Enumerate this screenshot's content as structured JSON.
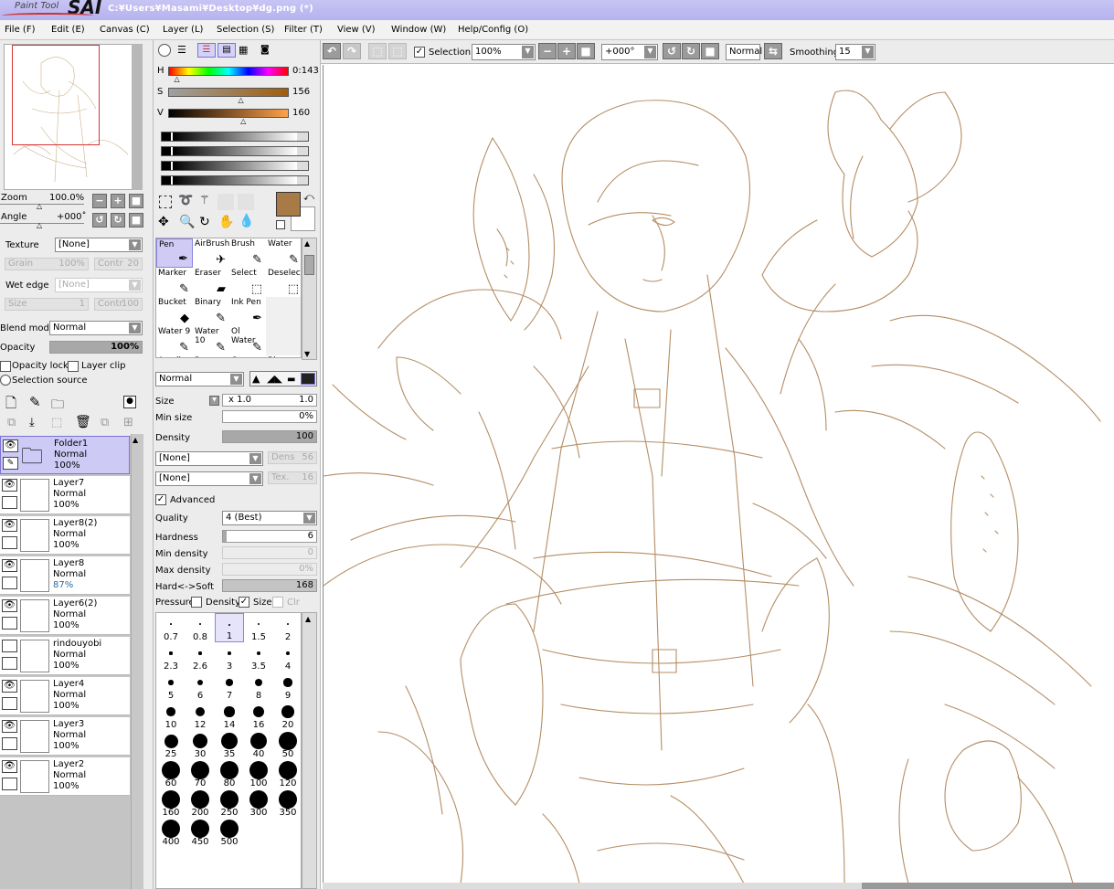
{
  "window": {
    "title": "C:¥Users¥Masami¥Desktop¥dg.png (*)",
    "app_logo_small": "Paint Tool",
    "app_logo_big": "SAI"
  },
  "menu": [
    "File (F)",
    "Edit (E)",
    "Canvas (C)",
    "Layer (L)",
    "Selection (S)",
    "Filter (T)",
    "View (V)",
    "Window (W)",
    "Help/Config (O)"
  ],
  "navigator": {
    "zoom_label": "Zoom",
    "zoom_value": "100.0%",
    "angle_label": "Angle",
    "angle_value": "+000˚"
  },
  "texture": {
    "label": "Texture",
    "value": "[None]",
    "grain_label": "Grain",
    "grain_value": "100%",
    "contr_label": "Contr",
    "contr_value": "20"
  },
  "wetedge": {
    "label": "Wet edge",
    "value": "[None]",
    "size_label": "Size",
    "size_value": "1",
    "contr_label": "Contr",
    "contr_value": "100"
  },
  "blend": {
    "label": "Blend mode",
    "value": "Normal",
    "opacity_label": "Opacity",
    "opacity_value": "100%",
    "opacity_level": 1.0,
    "opacity_lock": "Opacity lock",
    "layer_clip": "Layer clip",
    "selection_source": "Selection source"
  },
  "layers": [
    {
      "name": "Folder1",
      "mode": "Normal",
      "opacity": "100%",
      "visible": true,
      "folder": true,
      "active": true
    },
    {
      "name": "Layer7",
      "mode": "Normal",
      "opacity": "100%",
      "visible": true
    },
    {
      "name": "Layer8(2)",
      "mode": "Normal",
      "opacity": "100%",
      "visible": true
    },
    {
      "name": "Layer8",
      "mode": "Normal",
      "opacity": "87%",
      "visible": true
    },
    {
      "name": "Layer6(2)",
      "mode": "Normal",
      "opacity": "100%",
      "visible": true
    },
    {
      "name": "rindouyobi",
      "mode": "Normal",
      "opacity": "100%",
      "visible": false
    },
    {
      "name": "Layer4",
      "mode": "Normal",
      "opacity": "100%",
      "visible": true
    },
    {
      "name": "Layer3",
      "mode": "Normal",
      "opacity": "100%",
      "visible": true
    },
    {
      "name": "Layer2",
      "mode": "Normal",
      "opacity": "100%",
      "visible": true
    }
  ],
  "color": {
    "h_label": "H",
    "h_value": "0:143",
    "s_label": "S",
    "s_value": "156",
    "v_label": "V",
    "v_value": "160",
    "h_level": 0.08,
    "s_level": 0.61,
    "v_level": 0.63,
    "primary": "#a87a45",
    "secondary": "#ffffff"
  },
  "tools": [
    {
      "name": "Pen",
      "icon": "✒",
      "active": true
    },
    {
      "name": "AirBrush",
      "icon": "✈"
    },
    {
      "name": "Brush",
      "icon": "✎"
    },
    {
      "name": "Water",
      "icon": "✎"
    },
    {
      "name": "Marker",
      "icon": "✎"
    },
    {
      "name": "Eraser",
      "icon": "▰"
    },
    {
      "name": "Select",
      "icon": "⬚"
    },
    {
      "name": "Deselect",
      "icon": "⬚"
    },
    {
      "name": "Bucket",
      "icon": "◆"
    },
    {
      "name": "Binary",
      "icon": "✎"
    },
    {
      "name": "Ink Pen",
      "icon": "✒"
    },
    {
      "name": "",
      "icon": ""
    },
    {
      "name": "Water 9",
      "icon": "✎"
    },
    {
      "name": "Water 10",
      "icon": "✎"
    },
    {
      "name": "Ol Water",
      "icon": "✎"
    },
    {
      "name": "",
      "icon": ""
    },
    {
      "name": "Acrylic",
      "icon": ""
    },
    {
      "name": "Paper",
      "icon": ""
    },
    {
      "name": "Crayon",
      "icon": ""
    },
    {
      "name": "Blur",
      "icon": ""
    }
  ],
  "brush": {
    "mode": "Normal",
    "size_label": "Size",
    "size_mult": "x 1.0",
    "size_value": "1.0",
    "minsize_label": "Min size",
    "minsize_value": "0%",
    "density_label": "Density",
    "density_value": "100",
    "density_level": 1.0,
    "tex1": "[None]",
    "dens_label": "Dens",
    "dens_value": "56",
    "tex2": "[None]",
    "tex_label": "Tex.",
    "tex_value": "16",
    "advanced": "Advanced",
    "quality_label": "Quality",
    "quality_value": "4 (Best)",
    "hardness_label": "Hardness",
    "hardness_value": "6",
    "mindensity_label": "Min density",
    "mindensity_value": "0",
    "maxdensity_label": "Max density",
    "maxdensity_value": "0%",
    "hardsoft_label": "Hard<->Soft",
    "hardsoft_value": "168",
    "pressure_label": "Pressure:",
    "p_density": "Density",
    "p_size": "Size",
    "p_clr": "Clr"
  },
  "brush_sizes": [
    "0.7",
    "0.8",
    "1",
    "1.5",
    "2",
    "2.3",
    "2.6",
    "3",
    "3.5",
    "4",
    "5",
    "6",
    "7",
    "8",
    "9",
    "10",
    "12",
    "14",
    "16",
    "20",
    "25",
    "30",
    "35",
    "40",
    "50",
    "60",
    "70",
    "80",
    "100",
    "120",
    "160",
    "200",
    "250",
    "300",
    "350",
    "400",
    "450",
    "500"
  ],
  "active_size": "1",
  "toolbar": {
    "selection_label": "Selection",
    "zoom_value": "100%",
    "angle_value": "+000°",
    "mode_value": "Normal",
    "smoothing_label": "Smoothing",
    "smoothing_value": "15"
  }
}
